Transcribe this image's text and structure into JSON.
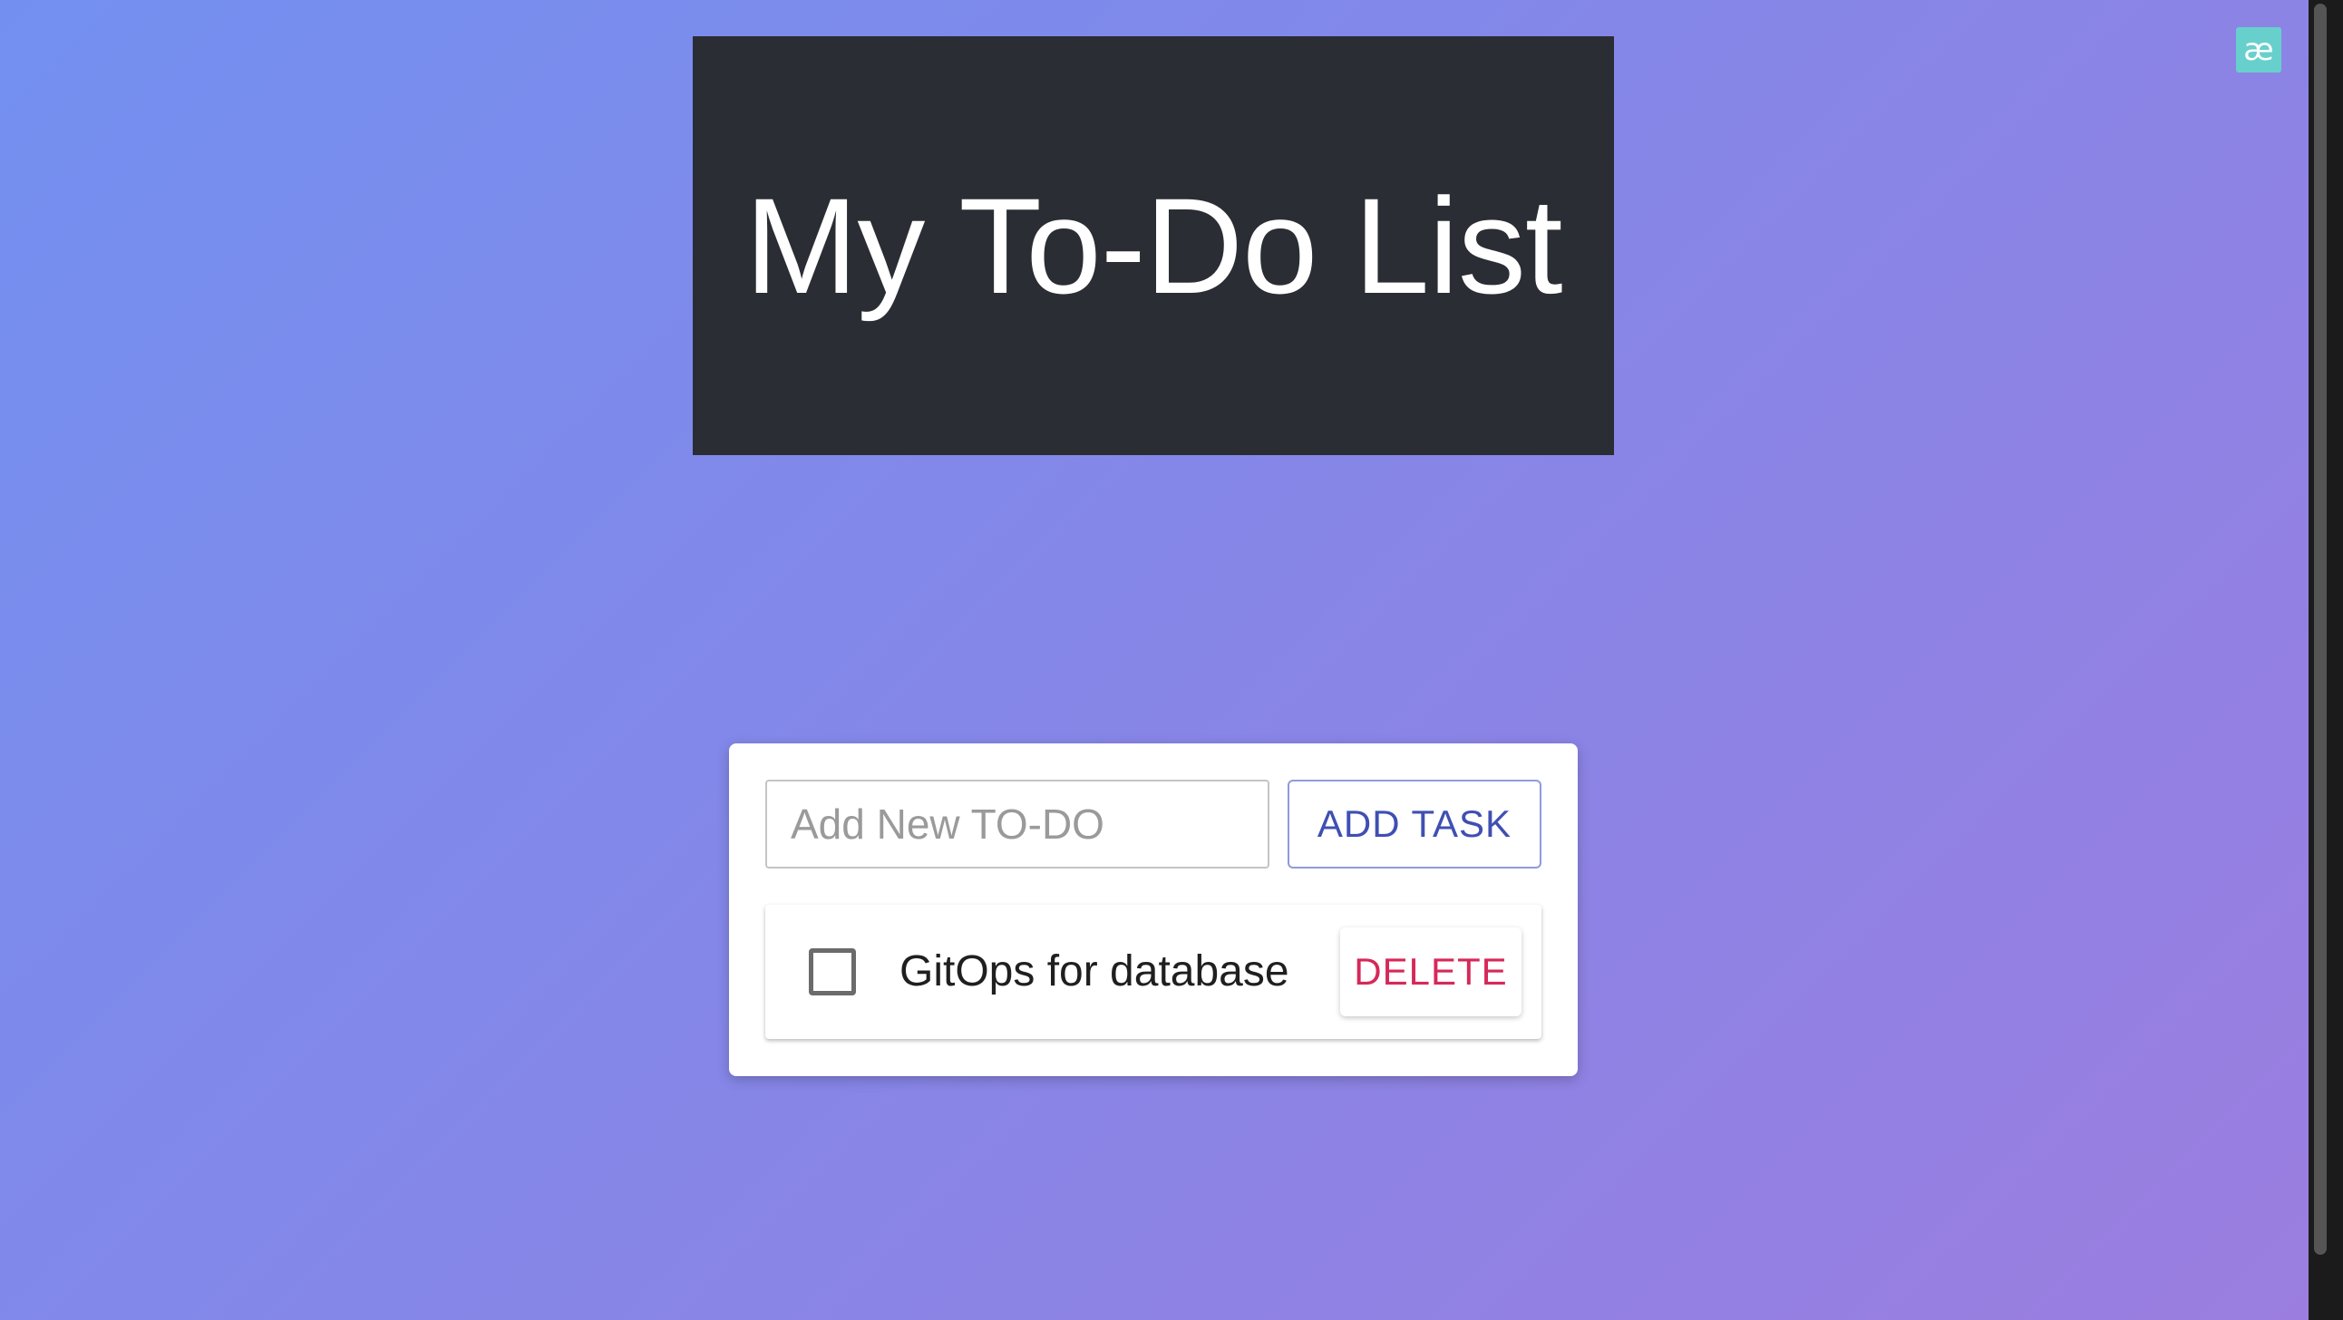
{
  "header": {
    "title": "My To-Do List"
  },
  "extension_badge": {
    "glyph": "æ",
    "icon": "extension-ae-icon",
    "color": "#67d0cc"
  },
  "form": {
    "input_placeholder": "Add New TO-DO",
    "input_value": "",
    "add_button_label": "ADD TASK"
  },
  "tasks": [
    {
      "text": "GitOps for database",
      "completed": false,
      "delete_label": "DELETE"
    }
  ],
  "colors": {
    "header_background": "#2a2d34",
    "add_button_text": "#3f4fb3",
    "delete_button_text": "#d6285a",
    "gradient_start": "#7390f0",
    "gradient_end": "#9b7ddf"
  }
}
